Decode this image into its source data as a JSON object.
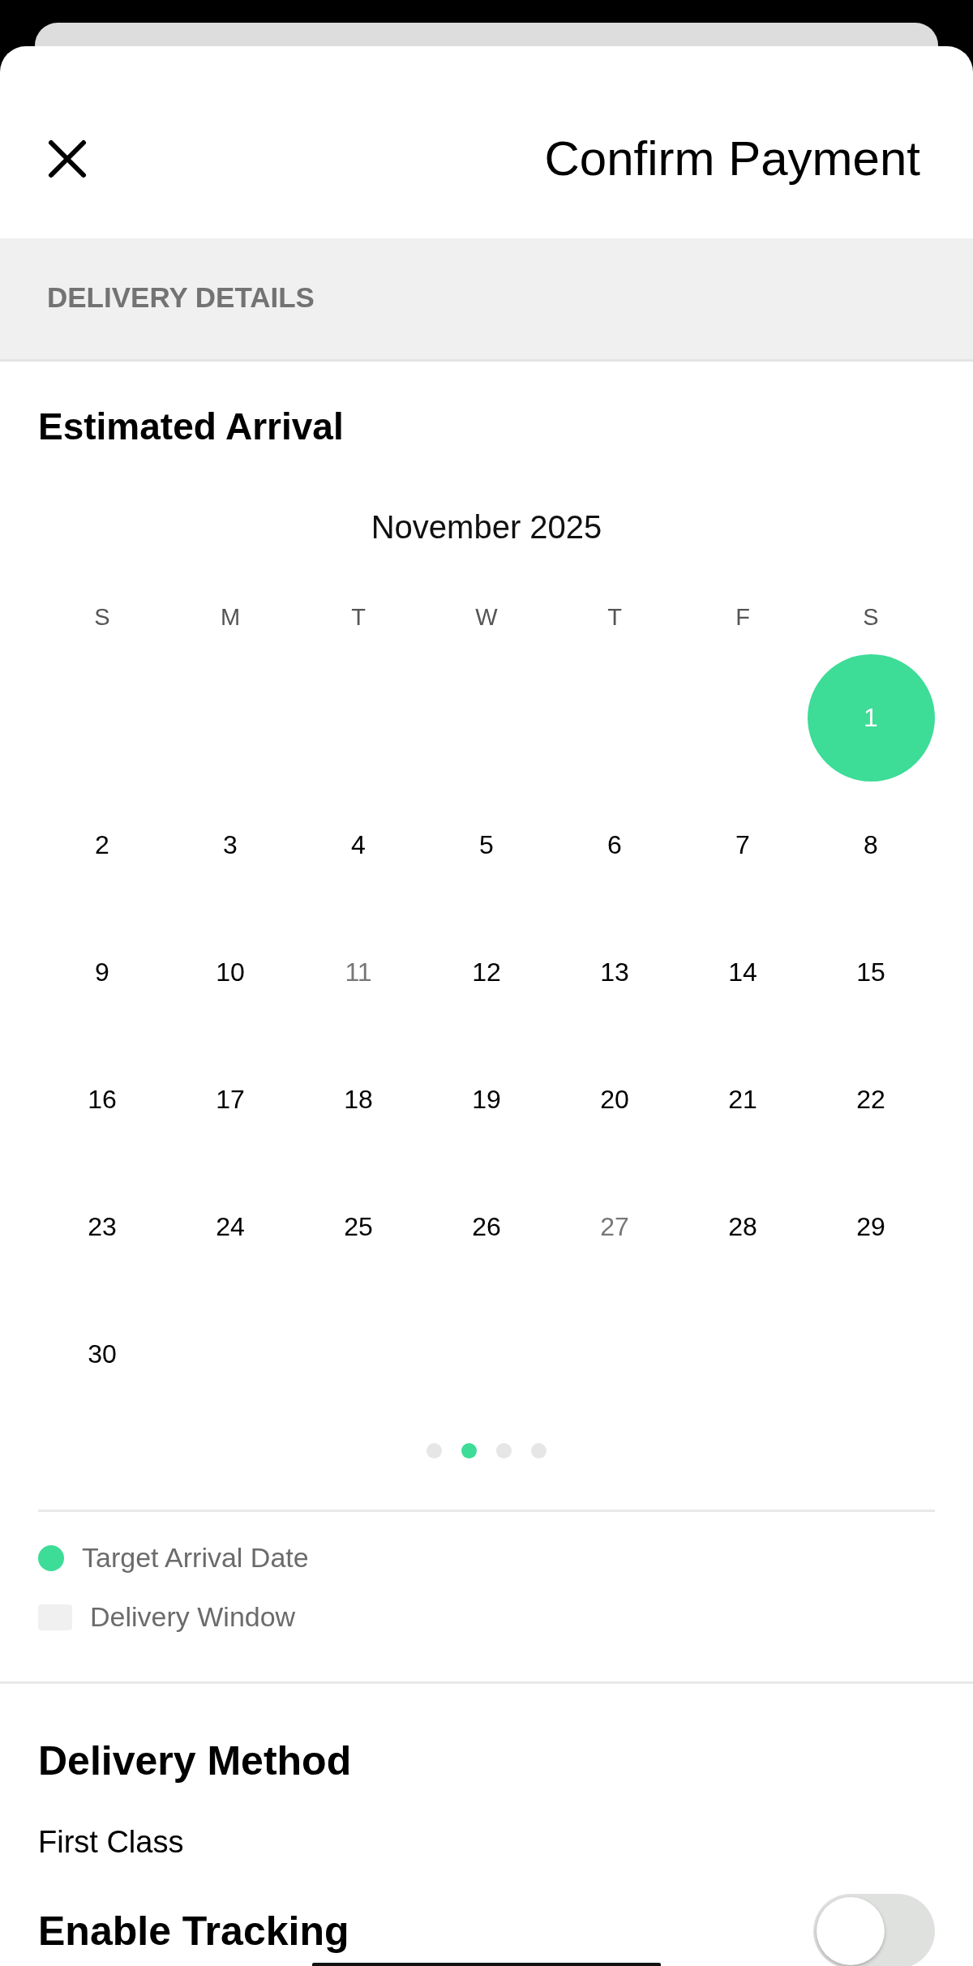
{
  "header": {
    "title": "Confirm Payment"
  },
  "section": {
    "title": "DELIVERY DETAILS"
  },
  "calendar": {
    "title": "Estimated Arrival",
    "month": "November 2025",
    "weekdays": [
      "S",
      "M",
      "T",
      "W",
      "T",
      "F",
      "S"
    ],
    "weeks": [
      [
        {
          "label": "1",
          "selected": true,
          "disabled": false
        }
      ],
      [
        {
          "label": "2",
          "selected": false,
          "disabled": false
        },
        {
          "label": "3",
          "selected": false,
          "disabled": false
        },
        {
          "label": "4",
          "selected": false,
          "disabled": false
        },
        {
          "label": "5",
          "selected": false,
          "disabled": false
        },
        {
          "label": "6",
          "selected": false,
          "disabled": false
        },
        {
          "label": "7",
          "selected": false,
          "disabled": false
        },
        {
          "label": "8",
          "selected": false,
          "disabled": false
        }
      ],
      [
        {
          "label": "9",
          "selected": false,
          "disabled": false
        },
        {
          "label": "10",
          "selected": false,
          "disabled": false
        },
        {
          "label": "11",
          "selected": false,
          "disabled": true
        },
        {
          "label": "12",
          "selected": false,
          "disabled": false
        },
        {
          "label": "13",
          "selected": false,
          "disabled": false
        },
        {
          "label": "14",
          "selected": false,
          "disabled": false
        },
        {
          "label": "15",
          "selected": false,
          "disabled": false
        }
      ],
      [
        {
          "label": "16",
          "selected": false,
          "disabled": false
        },
        {
          "label": "17",
          "selected": false,
          "disabled": false
        },
        {
          "label": "18",
          "selected": false,
          "disabled": false
        },
        {
          "label": "19",
          "selected": false,
          "disabled": false
        },
        {
          "label": "20",
          "selected": false,
          "disabled": false
        },
        {
          "label": "21",
          "selected": false,
          "disabled": false
        },
        {
          "label": "22",
          "selected": false,
          "disabled": false
        }
      ],
      [
        {
          "label": "23",
          "selected": false,
          "disabled": false
        },
        {
          "label": "24",
          "selected": false,
          "disabled": false
        },
        {
          "label": "25",
          "selected": false,
          "disabled": false
        },
        {
          "label": "26",
          "selected": false,
          "disabled": false
        },
        {
          "label": "27",
          "selected": false,
          "disabled": true
        },
        {
          "label": "28",
          "selected": false,
          "disabled": false
        },
        {
          "label": "29",
          "selected": false,
          "disabled": false
        }
      ],
      [
        {
          "label": "30",
          "selected": false,
          "disabled": false
        }
      ]
    ],
    "pages": [
      {
        "selected": false
      },
      {
        "selected": true
      },
      {
        "selected": false
      },
      {
        "selected": false
      }
    ]
  },
  "legend": [
    {
      "kind": "dot",
      "label": "Target Arrival Date",
      "color": "#3ddc97"
    },
    {
      "kind": "swatch",
      "label": "Delivery Window",
      "color": "#f0f0f0"
    }
  ],
  "delivery_method": {
    "title": "Delivery Method",
    "value": "First Class"
  },
  "tracking": {
    "label": "Enable Tracking",
    "on": false
  }
}
